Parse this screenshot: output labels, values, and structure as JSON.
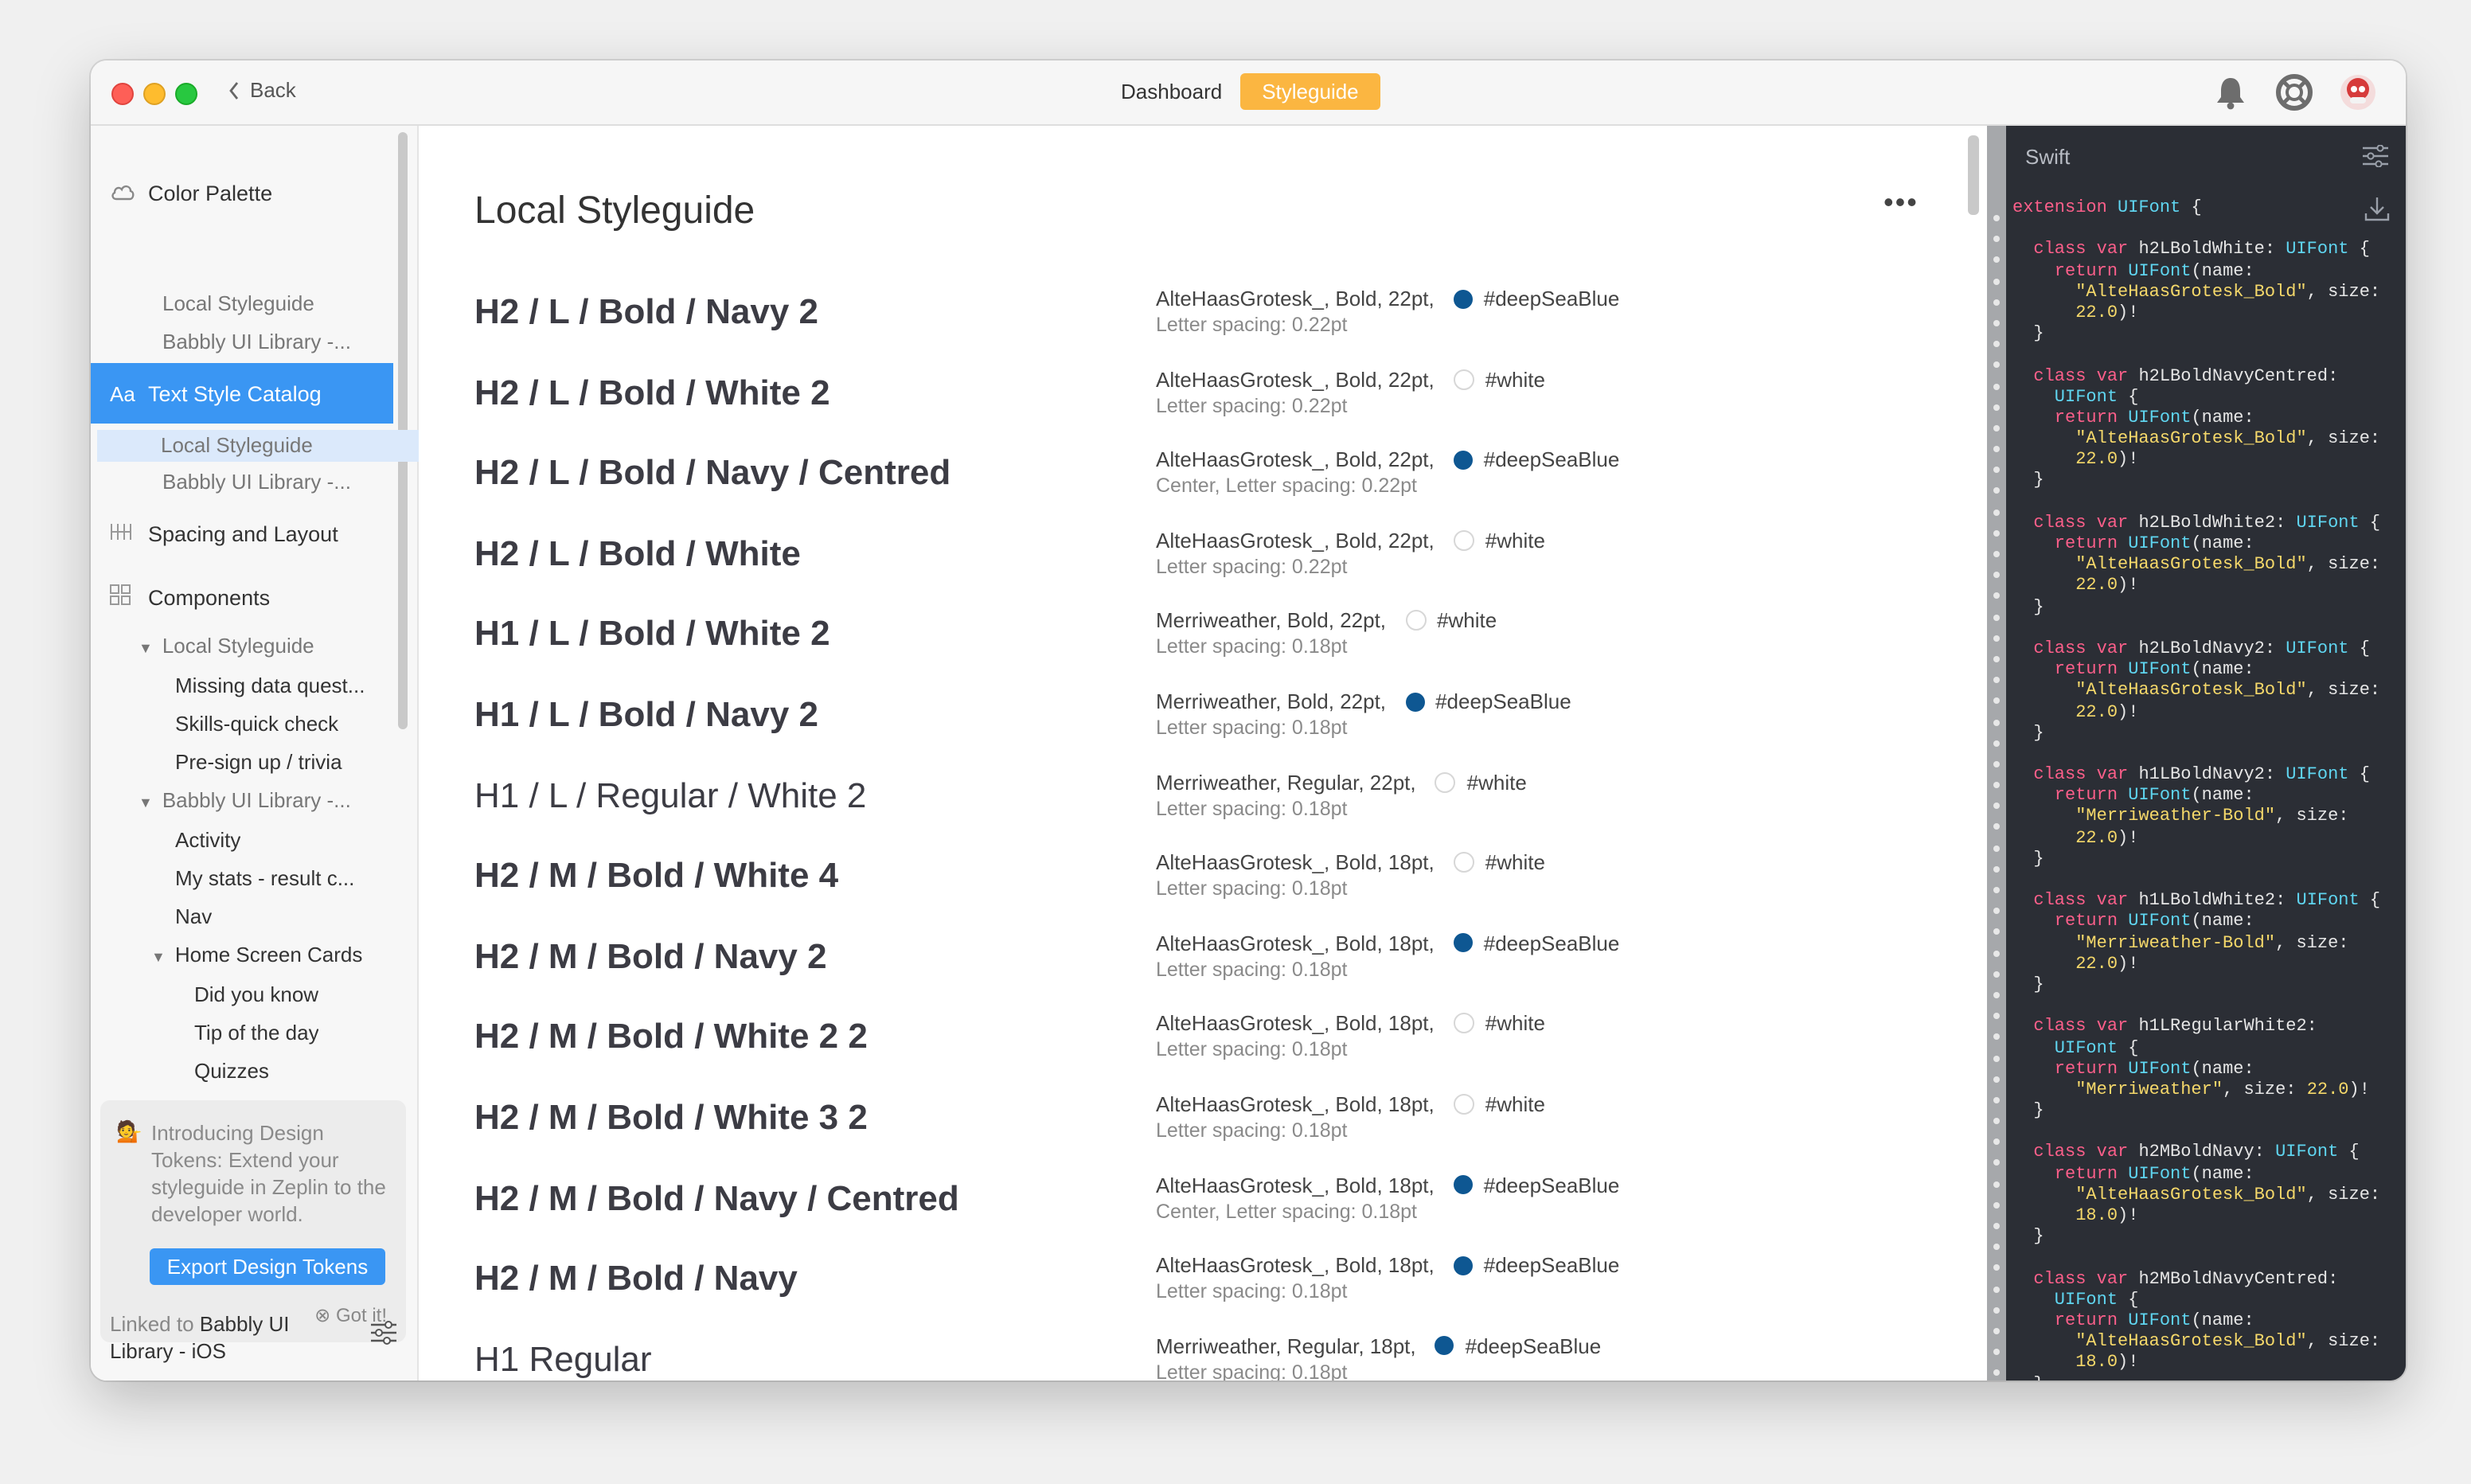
{
  "window": {
    "back_label": "Back",
    "tabs": [
      {
        "label": "Dashboard",
        "active": false
      },
      {
        "label": "Styleguide",
        "active": true
      }
    ],
    "accent": "#fbb641"
  },
  "sidebar": {
    "color_palette": {
      "label": "Color Palette",
      "items": [
        "Local Styleguide",
        "Babbly UI Library -..."
      ]
    },
    "text_style_catalog": {
      "label": "Text Style Catalog",
      "icon": "Aa",
      "items": [
        "Local Styleguide",
        "Babbly UI Library -..."
      ]
    },
    "spacing": {
      "label": "Spacing and Layout"
    },
    "components": {
      "label": "Components",
      "local": {
        "label": "Local Styleguide",
        "items": [
          "Missing data quest...",
          "Skills-quick check",
          "Pre-sign up / trivia"
        ]
      },
      "babbly": {
        "label": "Babbly UI Library -...",
        "items": [
          "Activity",
          "My stats - result c...",
          "Nav"
        ]
      },
      "home": {
        "label": "Home Screen Cards",
        "items": [
          "Did you know",
          "Tip of the day",
          "Quizzes"
        ]
      }
    },
    "promo": {
      "emoji": "💁",
      "text": "Introducing Design Tokens: Extend your styleguide in Zeplin to the developer world.",
      "button": "Export Design Tokens",
      "dismiss": "Got it!"
    },
    "linked": {
      "prefix": "Linked to ",
      "name": "Babbly UI Library - iOS"
    },
    "selected_color": "#3a96f3"
  },
  "main": {
    "title": "Local Styleguide",
    "more": "•••",
    "rows": [
      {
        "name": "H2 / L / Bold / Navy 2",
        "desc": "AlteHaasGrotesk_, Bold, 22pt,",
        "color": "#deepSeaBlue",
        "swatch": "navy",
        "sub": "Letter spacing: 0.22pt",
        "weight": "bold"
      },
      {
        "name": "H2 / L / Bold / White 2",
        "desc": "AlteHaasGrotesk_, Bold, 22pt,",
        "color": "#white",
        "swatch": "white",
        "sub": "Letter spacing: 0.22pt",
        "weight": "bold"
      },
      {
        "name": "H2 / L / Bold / Navy / Centred",
        "desc": "AlteHaasGrotesk_, Bold, 22pt,",
        "color": "#deepSeaBlue",
        "swatch": "navy",
        "sub": "Center, Letter spacing: 0.22pt",
        "weight": "bold"
      },
      {
        "name": "H2 / L / Bold / White",
        "desc": "AlteHaasGrotesk_, Bold, 22pt,",
        "color": "#white",
        "swatch": "white",
        "sub": "Letter spacing: 0.22pt",
        "weight": "bold"
      },
      {
        "name": "H1 / L / Bold / White 2",
        "desc": "Merriweather, Bold, 22pt,",
        "color": "#white",
        "swatch": "white",
        "sub": "Letter spacing: 0.18pt",
        "weight": "bold"
      },
      {
        "name": "H1 / L / Bold / Navy 2",
        "desc": "Merriweather, Bold, 22pt,",
        "color": "#deepSeaBlue",
        "swatch": "navy",
        "sub": "Letter spacing: 0.18pt",
        "weight": "bold"
      },
      {
        "name": "H1 / L / Regular / White 2",
        "desc": "Merriweather, Regular, 22pt,",
        "color": "#white",
        "swatch": "white",
        "sub": "Letter spacing: 0.18pt",
        "weight": "regular"
      },
      {
        "name": "H2 / M / Bold / White 4",
        "desc": "AlteHaasGrotesk_, Bold, 18pt,",
        "color": "#white",
        "swatch": "white",
        "sub": "Letter spacing: 0.18pt",
        "weight": "bold"
      },
      {
        "name": "H2 / M / Bold / Navy 2",
        "desc": "AlteHaasGrotesk_, Bold, 18pt,",
        "color": "#deepSeaBlue",
        "swatch": "navy",
        "sub": "Letter spacing: 0.18pt",
        "weight": "bold"
      },
      {
        "name": "H2 / M / Bold / White 2 2",
        "desc": "AlteHaasGrotesk_, Bold, 18pt,",
        "color": "#white",
        "swatch": "white",
        "sub": "Letter spacing: 0.18pt",
        "weight": "bold"
      },
      {
        "name": "H2 / M / Bold / White 3 2",
        "desc": "AlteHaasGrotesk_, Bold, 18pt,",
        "color": "#white",
        "swatch": "white",
        "sub": "Letter spacing: 0.18pt",
        "weight": "bold"
      },
      {
        "name": "H2 / M / Bold / Navy / Centred",
        "desc": "AlteHaasGrotesk_, Bold, 18pt,",
        "color": "#deepSeaBlue",
        "swatch": "navy",
        "sub": "Center, Letter spacing: 0.18pt",
        "weight": "bold"
      },
      {
        "name": "H2 / M / Bold / Navy",
        "desc": "AlteHaasGrotesk_, Bold, 18pt,",
        "color": "#deepSeaBlue",
        "swatch": "navy",
        "sub": "Letter spacing: 0.18pt",
        "weight": "bold"
      },
      {
        "name": "H1 Regular",
        "desc": "Merriweather, Regular, 18pt,",
        "color": "#deepSeaBlue",
        "swatch": "navy",
        "sub": "Letter spacing: 0.18pt",
        "weight": "regular"
      }
    ]
  },
  "code": {
    "language": "Swift",
    "lines": [
      [
        [
          "k",
          "extension "
        ],
        [
          "t",
          "UIFont"
        ],
        [
          "p",
          " {"
        ]
      ],
      [
        [
          "p",
          ""
        ]
      ],
      [
        [
          "k",
          "  class var "
        ],
        [
          "p",
          "h2LBoldWhite: "
        ],
        [
          "t",
          "UIFont"
        ],
        [
          "p",
          " {"
        ]
      ],
      [
        [
          "k",
          "    return "
        ],
        [
          "t",
          "UIFont"
        ],
        [
          "p",
          "(name:"
        ]
      ],
      [
        [
          "s",
          "      \"AlteHaasGrotesk_Bold\""
        ],
        [
          "p",
          ", size:"
        ]
      ],
      [
        [
          "n",
          "      22.0"
        ],
        [
          "p",
          ")!"
        ]
      ],
      [
        [
          "p",
          "  }"
        ]
      ],
      [
        [
          "p",
          ""
        ]
      ],
      [
        [
          "k",
          "  class var "
        ],
        [
          "p",
          "h2LBoldNavyCentred:"
        ]
      ],
      [
        [
          "t",
          "    UIFont"
        ],
        [
          "p",
          " {"
        ]
      ],
      [
        [
          "k",
          "    return "
        ],
        [
          "t",
          "UIFont"
        ],
        [
          "p",
          "(name:"
        ]
      ],
      [
        [
          "s",
          "      \"AlteHaasGrotesk_Bold\""
        ],
        [
          "p",
          ", size:"
        ]
      ],
      [
        [
          "n",
          "      22.0"
        ],
        [
          "p",
          ")!"
        ]
      ],
      [
        [
          "p",
          "  }"
        ]
      ],
      [
        [
          "p",
          ""
        ]
      ],
      [
        [
          "k",
          "  class var "
        ],
        [
          "p",
          "h2LBoldWhite2: "
        ],
        [
          "t",
          "UIFont"
        ],
        [
          "p",
          " {"
        ]
      ],
      [
        [
          "k",
          "    return "
        ],
        [
          "t",
          "UIFont"
        ],
        [
          "p",
          "(name:"
        ]
      ],
      [
        [
          "s",
          "      \"AlteHaasGrotesk_Bold\""
        ],
        [
          "p",
          ", size:"
        ]
      ],
      [
        [
          "n",
          "      22.0"
        ],
        [
          "p",
          ")!"
        ]
      ],
      [
        [
          "p",
          "  }"
        ]
      ],
      [
        [
          "p",
          ""
        ]
      ],
      [
        [
          "k",
          "  class var "
        ],
        [
          "p",
          "h2LBoldNavy2: "
        ],
        [
          "t",
          "UIFont"
        ],
        [
          "p",
          " {"
        ]
      ],
      [
        [
          "k",
          "    return "
        ],
        [
          "t",
          "UIFont"
        ],
        [
          "p",
          "(name:"
        ]
      ],
      [
        [
          "s",
          "      \"AlteHaasGrotesk_Bold\""
        ],
        [
          "p",
          ", size:"
        ]
      ],
      [
        [
          "n",
          "      22.0"
        ],
        [
          "p",
          ")!"
        ]
      ],
      [
        [
          "p",
          "  }"
        ]
      ],
      [
        [
          "p",
          ""
        ]
      ],
      [
        [
          "k",
          "  class var "
        ],
        [
          "p",
          "h1LBoldNavy2: "
        ],
        [
          "t",
          "UIFont"
        ],
        [
          "p",
          " {"
        ]
      ],
      [
        [
          "k",
          "    return "
        ],
        [
          "t",
          "UIFont"
        ],
        [
          "p",
          "(name:"
        ]
      ],
      [
        [
          "s",
          "      \"Merriweather-Bold\""
        ],
        [
          "p",
          ", size:"
        ]
      ],
      [
        [
          "n",
          "      22.0"
        ],
        [
          "p",
          ")!"
        ]
      ],
      [
        [
          "p",
          "  }"
        ]
      ],
      [
        [
          "p",
          ""
        ]
      ],
      [
        [
          "k",
          "  class var "
        ],
        [
          "p",
          "h1LBoldWhite2: "
        ],
        [
          "t",
          "UIFont"
        ],
        [
          "p",
          " {"
        ]
      ],
      [
        [
          "k",
          "    return "
        ],
        [
          "t",
          "UIFont"
        ],
        [
          "p",
          "(name:"
        ]
      ],
      [
        [
          "s",
          "      \"Merriweather-Bold\""
        ],
        [
          "p",
          ", size:"
        ]
      ],
      [
        [
          "n",
          "      22.0"
        ],
        [
          "p",
          ")!"
        ]
      ],
      [
        [
          "p",
          "  }"
        ]
      ],
      [
        [
          "p",
          ""
        ]
      ],
      [
        [
          "k",
          "  class var "
        ],
        [
          "p",
          "h1LRegularWhite2:"
        ]
      ],
      [
        [
          "t",
          "    UIFont"
        ],
        [
          "p",
          " {"
        ]
      ],
      [
        [
          "k",
          "    return "
        ],
        [
          "t",
          "UIFont"
        ],
        [
          "p",
          "(name:"
        ]
      ],
      [
        [
          "s",
          "      \"Merriweather\""
        ],
        [
          "p",
          ", size: "
        ],
        [
          "n",
          "22.0"
        ],
        [
          "p",
          ")!"
        ]
      ],
      [
        [
          "p",
          "  }"
        ]
      ],
      [
        [
          "p",
          ""
        ]
      ],
      [
        [
          "k",
          "  class var "
        ],
        [
          "p",
          "h2MBoldNavy: "
        ],
        [
          "t",
          "UIFont"
        ],
        [
          "p",
          " {"
        ]
      ],
      [
        [
          "k",
          "    return "
        ],
        [
          "t",
          "UIFont"
        ],
        [
          "p",
          "(name:"
        ]
      ],
      [
        [
          "s",
          "      \"AlteHaasGrotesk_Bold\""
        ],
        [
          "p",
          ", size:"
        ]
      ],
      [
        [
          "n",
          "      18.0"
        ],
        [
          "p",
          ")!"
        ]
      ],
      [
        [
          "p",
          "  }"
        ]
      ],
      [
        [
          "p",
          ""
        ]
      ],
      [
        [
          "k",
          "  class var "
        ],
        [
          "p",
          "h2MBoldNavyCentred:"
        ]
      ],
      [
        [
          "t",
          "    UIFont"
        ],
        [
          "p",
          " {"
        ]
      ],
      [
        [
          "k",
          "    return "
        ],
        [
          "t",
          "UIFont"
        ],
        [
          "p",
          "(name:"
        ]
      ],
      [
        [
          "s",
          "      \"AlteHaasGrotesk_Bold\""
        ],
        [
          "p",
          ", size:"
        ]
      ],
      [
        [
          "n",
          "      18.0"
        ],
        [
          "p",
          ")!"
        ]
      ],
      [
        [
          "p",
          "  }"
        ]
      ]
    ]
  }
}
